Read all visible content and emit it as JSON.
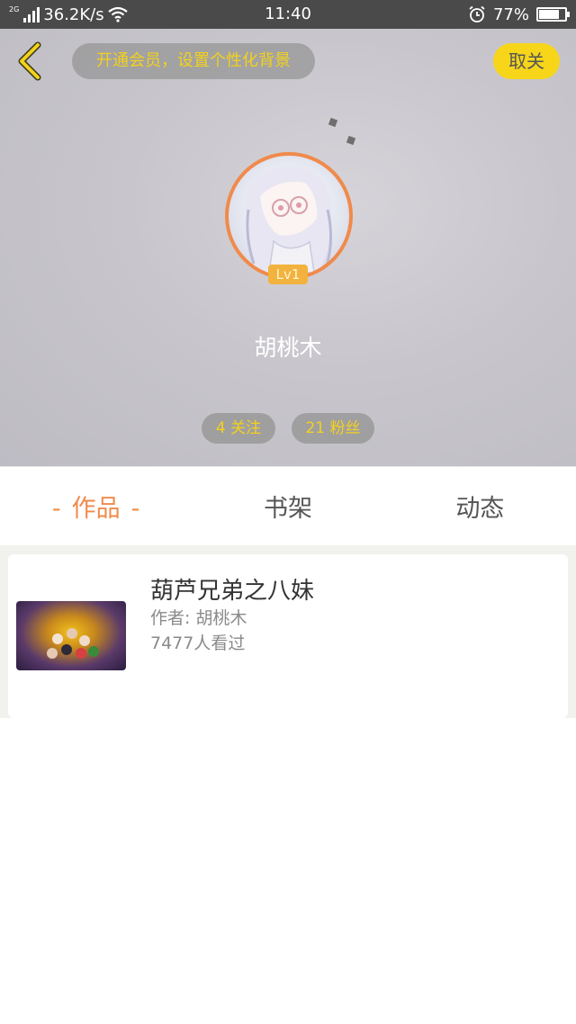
{
  "status_bar": {
    "network_type": "2G",
    "speed": "36.2K/s",
    "time": "11:40",
    "battery_percent": "77%",
    "battery_level": 0.77
  },
  "header": {
    "vip_prompt": "开通会员，设置个性化背景",
    "unfollow_label": "取关",
    "level": "Lv1",
    "username": "胡桃木",
    "following": "4 关注",
    "followers": "21 粉丝"
  },
  "tabs": [
    {
      "label": "作品",
      "active": true,
      "dash": "-"
    },
    {
      "label": "书架",
      "active": false
    },
    {
      "label": "动态",
      "active": false
    }
  ],
  "works": [
    {
      "title": "葫芦兄弟之八妹",
      "author": "作者: 胡桃木",
      "views": "7477人看过"
    }
  ],
  "colors": {
    "accent_orange": "#f08a4b",
    "accent_yellow": "#f7d61a",
    "pill_text_yellow": "#f3d11b"
  },
  "icons": {
    "back": "chevron-left-icon",
    "wifi": "wifi-icon",
    "alarm": "alarm-icon",
    "battery": "battery-icon",
    "signal": "signal-icon"
  }
}
